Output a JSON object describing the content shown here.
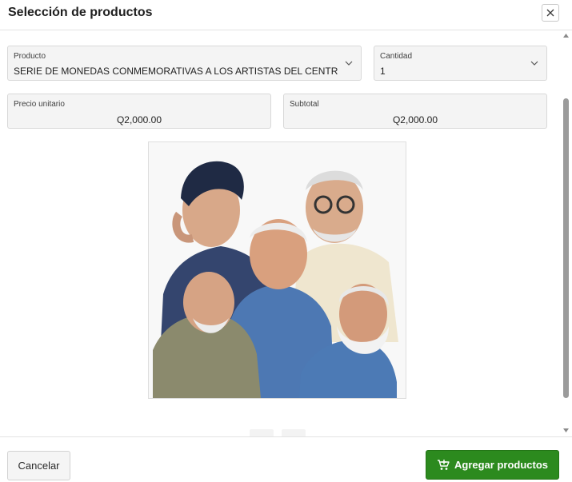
{
  "dialog": {
    "title": "Selección de productos",
    "close_icon": "close-icon"
  },
  "form": {
    "product": {
      "label": "Producto",
      "value": "SERIE DE MONEDAS CONMEMORATIVAS A LOS ARTISTAS DEL CENTRO"
    },
    "quantity": {
      "label": "Cantidad",
      "value": "1"
    },
    "unit_price": {
      "label": "Precio unitario",
      "value": "Q2,000.00"
    },
    "subtotal": {
      "label": "Subtotal",
      "value": "Q2,000.00"
    }
  },
  "product_image": {
    "icon": "artists-portrait-illustration"
  },
  "footer": {
    "cancel_label": "Cancelar",
    "add_label": "Agregar productos",
    "add_icon": "cart-plus-icon"
  },
  "colors": {
    "accent": "#2c8a1e",
    "field_bg": "#f4f4f4"
  }
}
